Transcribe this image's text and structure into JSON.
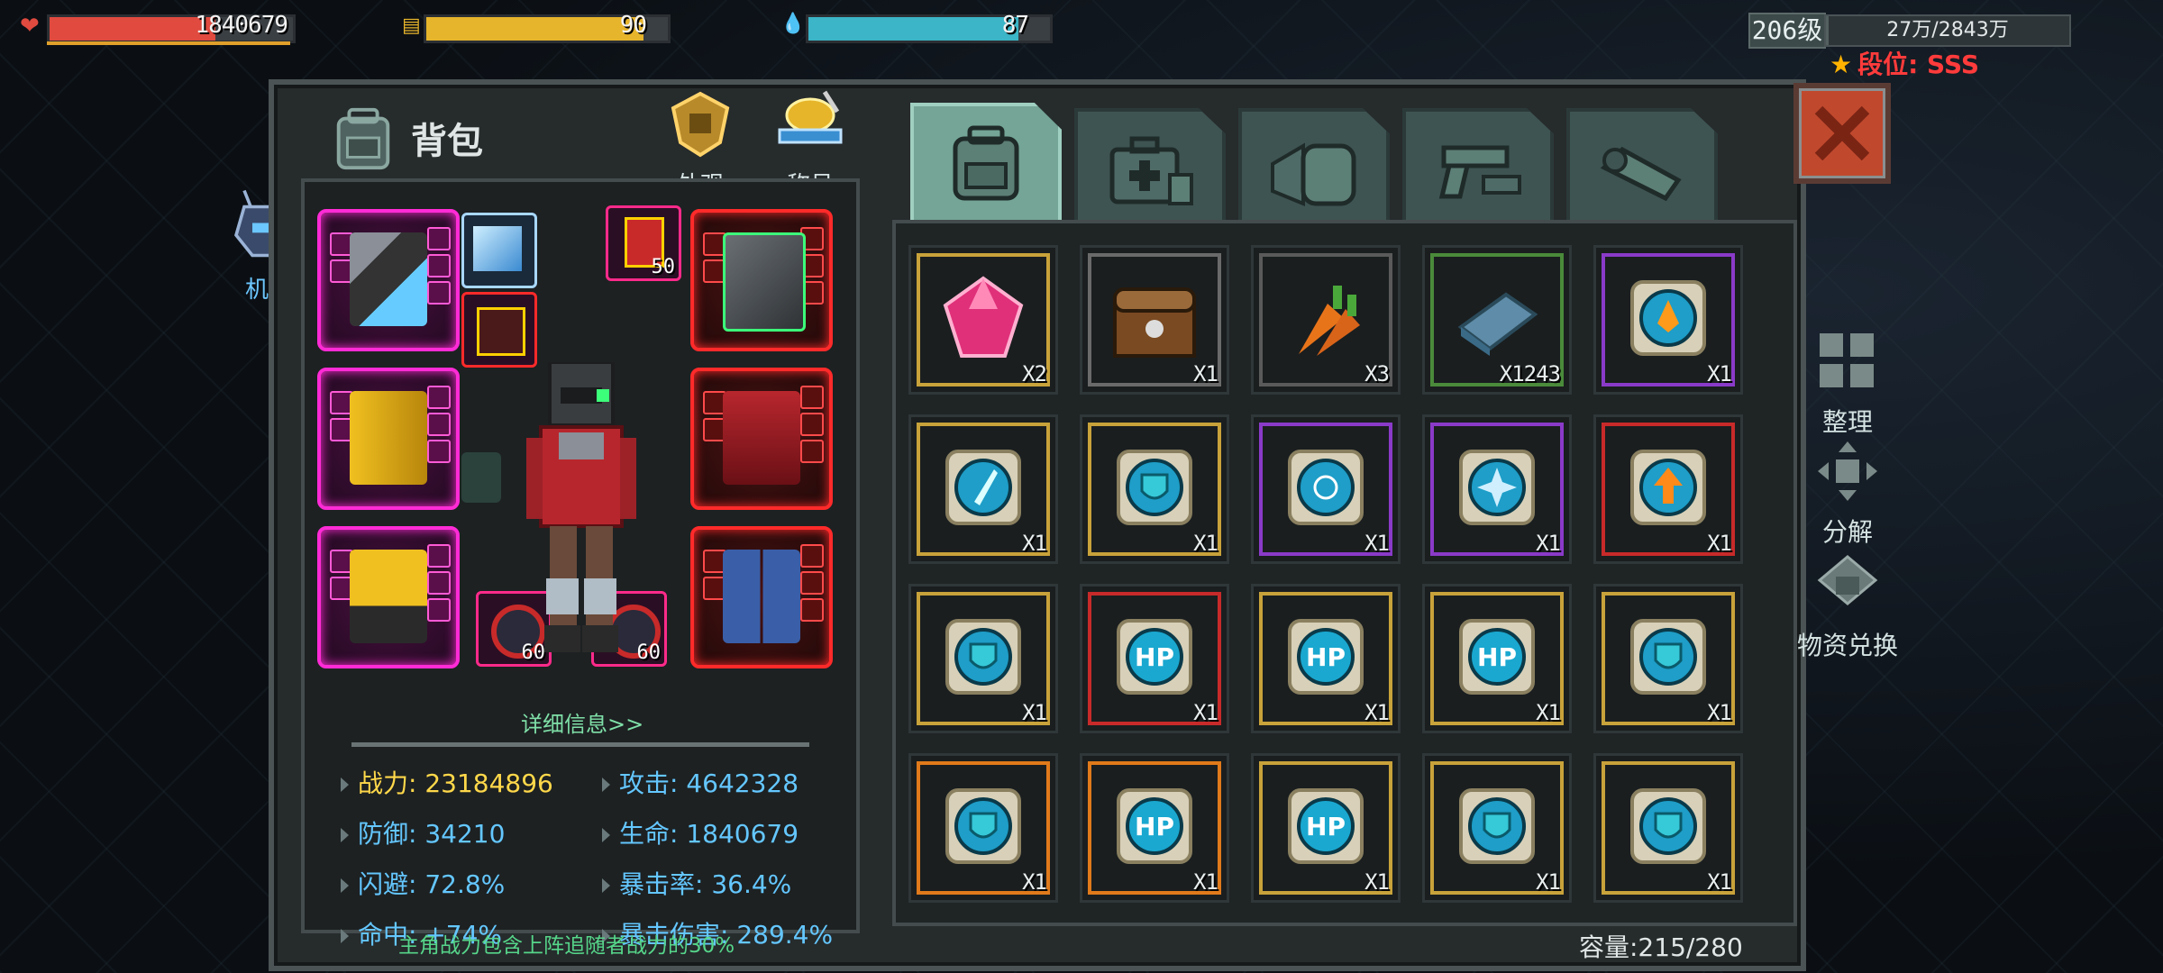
{
  "hud": {
    "hp": {
      "value": "1840679",
      "fill": 0.68,
      "color": "#e04a3f"
    },
    "food": {
      "value": "90",
      "fill": 0.9,
      "color": "#e7b52b"
    },
    "water": {
      "value": "87",
      "fill": 0.87,
      "color": "#3bb5c7"
    },
    "level": "206级",
    "exp_text": "27万/2843万",
    "exp_fill": 0.01,
    "rank": "段位: SSS"
  },
  "panel": {
    "title": "背包",
    "appearance_label": "外观",
    "title_label": "称号",
    "mecha_label": "机甲",
    "tabs": [
      {
        "name": "backpack",
        "icon": "backpack-icon",
        "active": true
      },
      {
        "name": "medical",
        "icon": "medkit-icon",
        "active": false
      },
      {
        "name": "food",
        "icon": "bread-icon",
        "active": false
      },
      {
        "name": "weapons",
        "icon": "gun-icon",
        "active": false
      },
      {
        "name": "tools",
        "icon": "wrench-icon",
        "active": false
      }
    ]
  },
  "equipment": {
    "slot_level_1": "50",
    "slot_level_2": "60",
    "slot_level_3": "60",
    "detail_link": "详细信息>>"
  },
  "stats": {
    "power": "战力: 23184896",
    "attack": "攻击: 4642328",
    "defense": "防御: 34210",
    "life": "生命: 1840679",
    "dodge": "闪避: 72.8%",
    "crit_rate": "暴击率: 36.4%",
    "hit": "命中: +74%",
    "crit_damage": "暴击伤害: 289.4%",
    "footnote": "主角战力包含上阵追随者战力的30%"
  },
  "inventory": {
    "capacity": "容量:215/280",
    "items": [
      {
        "icon": "ruby-icon",
        "qty": "X2",
        "rarity": "#c8a23a"
      },
      {
        "icon": "treasure-chest-icon",
        "qty": "X1",
        "rarity": "#6a6a6a"
      },
      {
        "icon": "carrot-icon",
        "qty": "X3",
        "rarity": "#5a5a5a"
      },
      {
        "icon": "cloth-icon",
        "qty": "X1243",
        "rarity": "#4a8a3a"
      },
      {
        "icon": "fire-chip-icon",
        "qty": "X1",
        "rarity": "#8a3ac8"
      },
      {
        "icon": "blade-chip-icon",
        "qty": "X1",
        "rarity": "#c8a23a"
      },
      {
        "icon": "shield-chip-icon",
        "qty": "X1",
        "rarity": "#c8a23a"
      },
      {
        "icon": "target-chip-icon",
        "qty": "X1",
        "rarity": "#8a3ac8"
      },
      {
        "icon": "burst-chip-icon",
        "qty": "X1",
        "rarity": "#8a3ac8"
      },
      {
        "icon": "arrow-chip-icon",
        "qty": "X1",
        "rarity": "#c82a2a"
      },
      {
        "icon": "shield-chip-icon",
        "qty": "X1",
        "rarity": "#c8a23a"
      },
      {
        "icon": "hp-chip-icon",
        "qty": "X1",
        "rarity": "#c82a2a"
      },
      {
        "icon": "hp-chip-icon",
        "qty": "X1",
        "rarity": "#c8a23a"
      },
      {
        "icon": "hp-chip-icon",
        "qty": "X1",
        "rarity": "#c8a23a"
      },
      {
        "icon": "shield-chip-icon",
        "qty": "X1",
        "rarity": "#c8a23a"
      },
      {
        "icon": "shield-chip-icon",
        "qty": "X1",
        "rarity": "#e07a1a"
      },
      {
        "icon": "hp-chip-icon",
        "qty": "X1",
        "rarity": "#e07a1a"
      },
      {
        "icon": "hp-chip-icon",
        "qty": "X1",
        "rarity": "#c8a23a"
      },
      {
        "icon": "shield-chip-icon",
        "qty": "X1",
        "rarity": "#c8a23a"
      },
      {
        "icon": "shield-chip-icon",
        "qty": "X1",
        "rarity": "#c8a23a"
      }
    ]
  },
  "side_actions": {
    "sort": "整理",
    "decompose": "分解",
    "exchange": "物资兑换"
  }
}
